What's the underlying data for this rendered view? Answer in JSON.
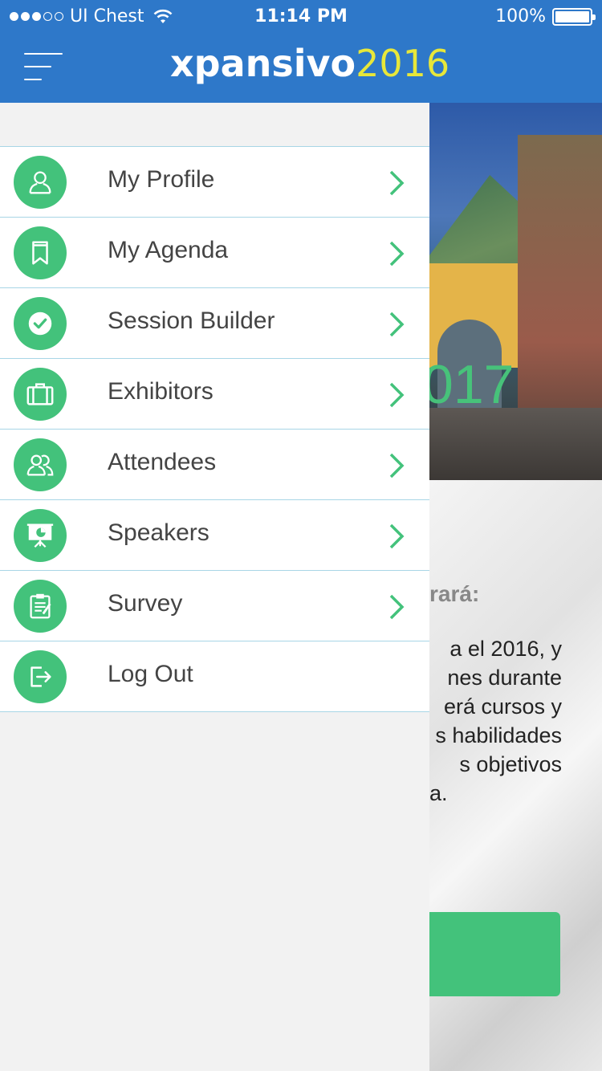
{
  "status": {
    "carrier": "UI Chest",
    "time": "11:14 PM",
    "battery": "100%"
  },
  "nav": {
    "logo_main": "xpansivo",
    "logo_year": "2016"
  },
  "menu": {
    "items": [
      {
        "label": "My Profile",
        "icon": "user-icon"
      },
      {
        "label": "My Agenda",
        "icon": "bookmark-icon"
      },
      {
        "label": "Session Builder",
        "icon": "check-circle-icon"
      },
      {
        "label": "Exhibitors",
        "icon": "briefcase-icon"
      },
      {
        "label": "Attendees",
        "icon": "users-icon"
      },
      {
        "label": "Speakers",
        "icon": "presentation-icon"
      },
      {
        "label": "Survey",
        "icon": "clipboard-icon"
      },
      {
        "label": "Log Out",
        "icon": "logout-icon"
      }
    ]
  },
  "background": {
    "hero_year": "017",
    "heading": "rará:",
    "para_lines": [
      "a el 2016, y",
      "nes durante",
      "erá cursos y",
      "s habilidades",
      "s   objetivos",
      "a."
    ]
  },
  "colors": {
    "nav_blue": "#2e78c9",
    "accent_green": "#43c27b",
    "logo_yellow": "#e7e73a",
    "divider": "#a8d6e6"
  }
}
